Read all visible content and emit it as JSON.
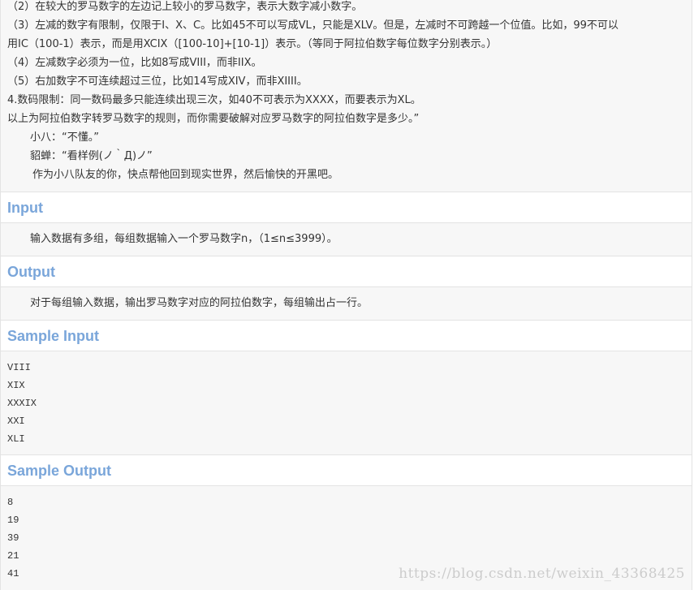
{
  "description": {
    "lines": [
      "（2）在较大的罗马数字的左边记上较小的罗马数字，表示大数字减小数字。",
      "（3）左减的数字有限制，仅限于I、X、C。比如45不可以写成VL，只能是XLV。但是，左减时不可跨越一个位值。比如，99不可以",
      "用IC（100-1）表示，而是用XCIX（[100-10]+[10-1]）表示。（等同于阿拉伯数字每位数字分别表示。）",
      "（4）左减数字必须为一位，比如8写成VIII，而非IIX。",
      "（5）右加数字不可连续超过三位，比如14写成XIV，而非XIIII。",
      "4.数码限制：同一数码最多只能连续出现三次，如40不可表示为XXXX，而要表示为XL。",
      "以上为阿拉伯数字转罗马数字的规则，而你需要破解对应罗马数字的阿拉伯数字是多少。”",
      "小八：“不懂。”",
      "貂蝉：“看样例(ノ｀Д)ノ”",
      "作为小八队友的你，快点帮他回到现实世界，然后愉快的开黑吧。"
    ]
  },
  "input": {
    "heading": "Input",
    "text": "输入数据有多组，每组数据输入一个罗马数字n，（1≤n≤3999）。"
  },
  "output": {
    "heading": "Output",
    "text": "对于每组输入数据，输出罗马数字对应的阿拉伯数字，每组输出占一行。"
  },
  "sample_input": {
    "heading": "Sample Input",
    "lines": [
      "VIII",
      "XIX",
      "XXXIX",
      "XXI",
      "XLI"
    ]
  },
  "sample_output": {
    "heading": "Sample Output",
    "lines": [
      "8",
      "19",
      "39",
      "21",
      "41"
    ]
  },
  "watermark": "https://blog.csdn.net/weixin_43368425",
  "colors": {
    "heading": "#7aa6da",
    "body_bg": "#f7f7f7",
    "border": "#e3e3e3"
  }
}
